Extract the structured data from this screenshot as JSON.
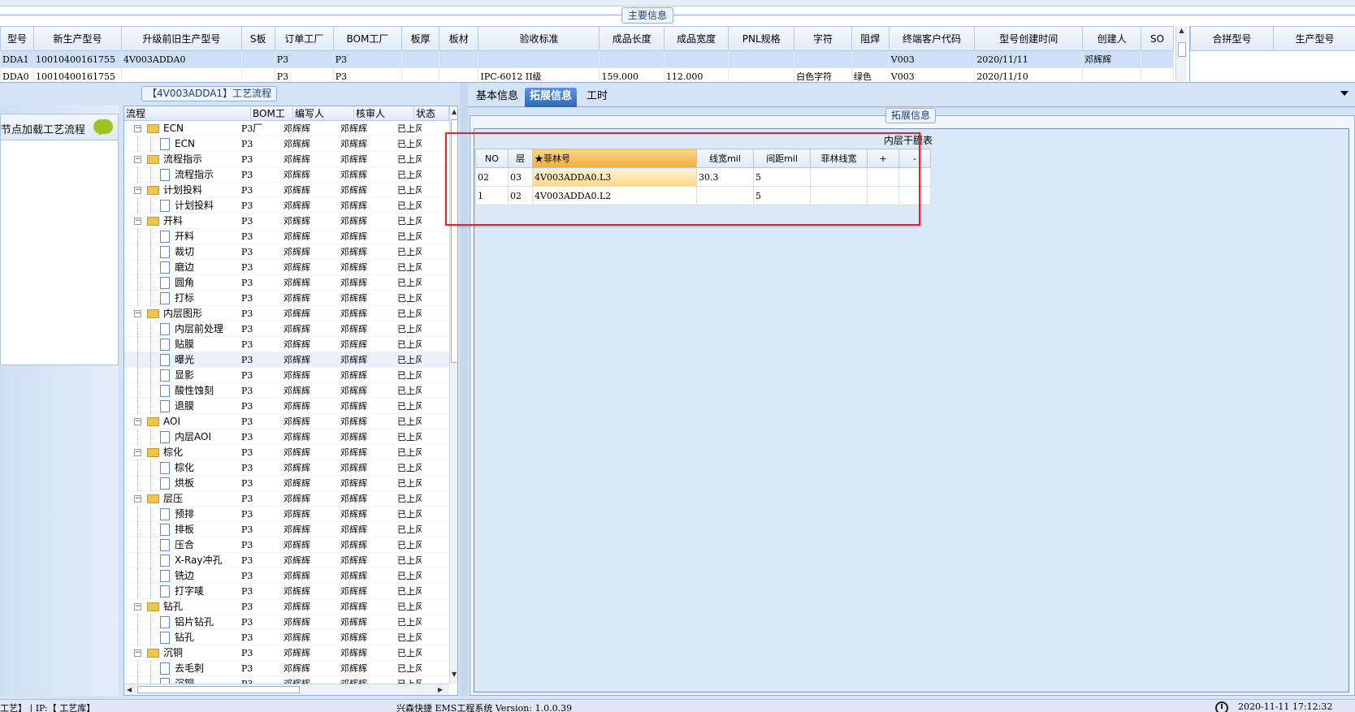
{
  "main_info": {
    "title": "主要信息",
    "columns": [
      "型号",
      "新生产型号",
      "升级前旧生产型号",
      "S板",
      "订单工厂",
      "BOM工厂",
      "板厚",
      "板材",
      "验收标准",
      "成品长度",
      "成品宽度",
      "PNL规格",
      "字符",
      "阻焊",
      "终端客户代码",
      "型号创建时间",
      "创建人",
      "SO"
    ],
    "rows": [
      [
        "DDA1",
        "10010400161755",
        "4V003ADDA0",
        "",
        "P3",
        "P3",
        "",
        "",
        "",
        "",
        "",
        "",
        "",
        "",
        "V003",
        "2020/11/11",
        "邓辉辉",
        ""
      ],
      [
        "DDA0",
        "10010400161755",
        "",
        "",
        "P3",
        "P3",
        "",
        "",
        "IPC-6012 II级",
        "159.000",
        "112.000",
        "",
        "白色字符",
        "绿色",
        "V003",
        "2020/11/10",
        "",
        ""
      ]
    ],
    "merge_columns": [
      "合拼型号",
      "生产型号"
    ]
  },
  "left_panel": {
    "node_load_label": "节点加载工艺流程"
  },
  "process_tree": {
    "title": "【4V003ADDA1】工艺流程",
    "columns": [
      "流程",
      "BOM工厂",
      "编写人",
      "核审人",
      "状态"
    ],
    "rows": [
      {
        "name": "ECN",
        "level": 0,
        "bom": "P3",
        "writer": "邓辉辉",
        "reviewer": "邓辉辉",
        "status": "已上风"
      },
      {
        "name": "ECN",
        "level": 1,
        "bom": "P3",
        "writer": "邓辉辉",
        "reviewer": "邓辉辉",
        "status": "已上风"
      },
      {
        "name": "流程指示",
        "level": 0,
        "bom": "P3",
        "writer": "邓辉辉",
        "reviewer": "邓辉辉",
        "status": "已上风"
      },
      {
        "name": "流程指示",
        "level": 1,
        "bom": "P3",
        "writer": "邓辉辉",
        "reviewer": "邓辉辉",
        "status": "已上风"
      },
      {
        "name": "计划投料",
        "level": 0,
        "bom": "P3",
        "writer": "邓辉辉",
        "reviewer": "邓辉辉",
        "status": "已上风"
      },
      {
        "name": "计划投料",
        "level": 1,
        "bom": "P3",
        "writer": "邓辉辉",
        "reviewer": "邓辉辉",
        "status": "已上风"
      },
      {
        "name": "开料",
        "level": 0,
        "bom": "P3",
        "writer": "邓辉辉",
        "reviewer": "邓辉辉",
        "status": "已上风"
      },
      {
        "name": "开料",
        "level": 1,
        "bom": "P3",
        "writer": "邓辉辉",
        "reviewer": "邓辉辉",
        "status": "已上风"
      },
      {
        "name": "裁切",
        "level": 1,
        "bom": "P3",
        "writer": "邓辉辉",
        "reviewer": "邓辉辉",
        "status": "已上风"
      },
      {
        "name": "磨边",
        "level": 1,
        "bom": "P3",
        "writer": "邓辉辉",
        "reviewer": "邓辉辉",
        "status": "已上风"
      },
      {
        "name": "圆角",
        "level": 1,
        "bom": "P3",
        "writer": "邓辉辉",
        "reviewer": "邓辉辉",
        "status": "已上风"
      },
      {
        "name": "打标",
        "level": 1,
        "bom": "P3",
        "writer": "邓辉辉",
        "reviewer": "邓辉辉",
        "status": "已上风"
      },
      {
        "name": "内层图形",
        "level": 0,
        "bom": "P3",
        "writer": "邓辉辉",
        "reviewer": "邓辉辉",
        "status": "已上风"
      },
      {
        "name": "内层前处理",
        "level": 1,
        "bom": "P3",
        "writer": "邓辉辉",
        "reviewer": "邓辉辉",
        "status": "已上风"
      },
      {
        "name": "贴膜",
        "level": 1,
        "bom": "P3",
        "writer": "邓辉辉",
        "reviewer": "邓辉辉",
        "status": "已上风"
      },
      {
        "name": "曝光",
        "level": 1,
        "bom": "P3",
        "writer": "邓辉辉",
        "reviewer": "邓辉辉",
        "status": "已上风",
        "selected": true
      },
      {
        "name": "显影",
        "level": 1,
        "bom": "P3",
        "writer": "邓辉辉",
        "reviewer": "邓辉辉",
        "status": "已上风"
      },
      {
        "name": "酸性蚀刻",
        "level": 1,
        "bom": "P3",
        "writer": "邓辉辉",
        "reviewer": "邓辉辉",
        "status": "已上风"
      },
      {
        "name": "退膜",
        "level": 1,
        "bom": "P3",
        "writer": "邓辉辉",
        "reviewer": "邓辉辉",
        "status": "已上风"
      },
      {
        "name": "AOI",
        "level": 0,
        "bom": "P3",
        "writer": "邓辉辉",
        "reviewer": "邓辉辉",
        "status": "已上风"
      },
      {
        "name": "内层AOI",
        "level": 1,
        "bom": "P3",
        "writer": "邓辉辉",
        "reviewer": "邓辉辉",
        "status": "已上风"
      },
      {
        "name": "棕化",
        "level": 0,
        "bom": "P3",
        "writer": "邓辉辉",
        "reviewer": "邓辉辉",
        "status": "已上风"
      },
      {
        "name": "棕化",
        "level": 1,
        "bom": "P3",
        "writer": "邓辉辉",
        "reviewer": "邓辉辉",
        "status": "已上风"
      },
      {
        "name": "烘板",
        "level": 1,
        "bom": "P3",
        "writer": "邓辉辉",
        "reviewer": "邓辉辉",
        "status": "已上风"
      },
      {
        "name": "层压",
        "level": 0,
        "bom": "P3",
        "writer": "邓辉辉",
        "reviewer": "邓辉辉",
        "status": "已上风"
      },
      {
        "name": "预排",
        "level": 1,
        "bom": "P3",
        "writer": "邓辉辉",
        "reviewer": "邓辉辉",
        "status": "已上风"
      },
      {
        "name": "排板",
        "level": 1,
        "bom": "P3",
        "writer": "邓辉辉",
        "reviewer": "邓辉辉",
        "status": "已上风"
      },
      {
        "name": "压合",
        "level": 1,
        "bom": "P3",
        "writer": "邓辉辉",
        "reviewer": "邓辉辉",
        "status": "已上风"
      },
      {
        "name": "X-Ray冲孔",
        "level": 1,
        "bom": "P3",
        "writer": "邓辉辉",
        "reviewer": "邓辉辉",
        "status": "已上风"
      },
      {
        "name": "铣边",
        "level": 1,
        "bom": "P3",
        "writer": "邓辉辉",
        "reviewer": "邓辉辉",
        "status": "已上风"
      },
      {
        "name": "打字唛",
        "level": 1,
        "bom": "P3",
        "writer": "邓辉辉",
        "reviewer": "邓辉辉",
        "status": "已上风"
      },
      {
        "name": "钻孔",
        "level": 0,
        "bom": "P3",
        "writer": "邓辉辉",
        "reviewer": "邓辉辉",
        "status": "已上风"
      },
      {
        "name": "铝片钻孔",
        "level": 1,
        "bom": "P3",
        "writer": "邓辉辉",
        "reviewer": "邓辉辉",
        "status": "已上风"
      },
      {
        "name": "钻孔",
        "level": 1,
        "bom": "P3",
        "writer": "邓辉辉",
        "reviewer": "邓辉辉",
        "status": "已上风"
      },
      {
        "name": "沉铜",
        "level": 0,
        "bom": "P3",
        "writer": "邓辉辉",
        "reviewer": "邓辉辉",
        "status": "已上风"
      },
      {
        "name": "去毛刺",
        "level": 1,
        "bom": "P3",
        "writer": "邓辉辉",
        "reviewer": "邓辉辉",
        "status": "已上风"
      },
      {
        "name": "沉铜",
        "level": 1,
        "bom": "P3",
        "writer": "邓辉辉",
        "reviewer": "邓辉辉",
        "status": "已上风"
      }
    ]
  },
  "tabs": [
    {
      "label": "基本信息",
      "active": false
    },
    {
      "label": "拓展信息",
      "active": true
    },
    {
      "label": "工时",
      "active": false
    }
  ],
  "ext_info": {
    "title": "拓展信息",
    "table_title": "内层干膜表",
    "columns": [
      "NO",
      "层",
      "★菲林号",
      "线宽mil",
      "间距mil",
      "菲林线宽",
      "+",
      "-"
    ],
    "rows": [
      [
        "02",
        "03",
        "4V003ADDA0.L3",
        "30.3",
        "5",
        "",
        "",
        ""
      ],
      [
        "1",
        "02",
        "4V003ADDA0.L2",
        "",
        "5",
        "",
        "",
        ""
      ]
    ]
  },
  "status_bar": {
    "left": "工艺】 | IP:【 工艺库】",
    "center": "兴森快捷 EMS工程系统 Version: 1.0.0.39",
    "right": "2020-11-11 17:12:32"
  },
  "colors": {
    "selection": "#cde0f7",
    "highlight_orange": "#f3ad3b",
    "red_annotation": "#e0252b",
    "active_tab": "#2d66b8"
  },
  "icons": [
    "chat-bubble-icon",
    "folder-icon",
    "file-icon",
    "clock-icon"
  ]
}
